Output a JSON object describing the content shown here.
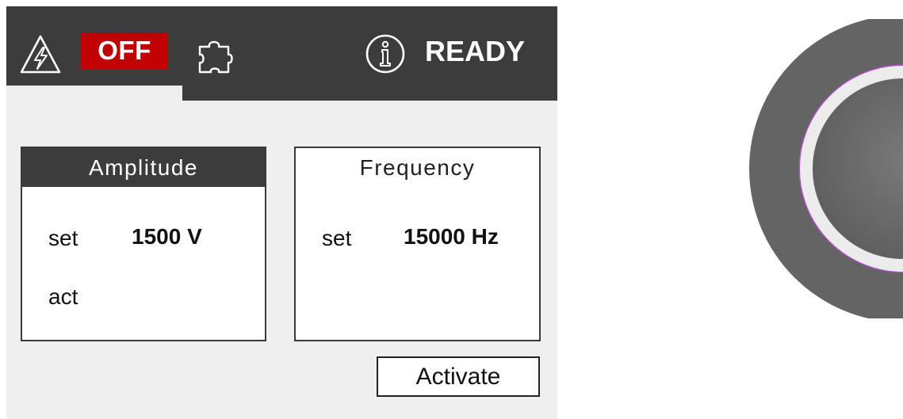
{
  "header": {
    "hv_icon": "high-voltage-warning-icon",
    "power_state": "OFF",
    "plugin_icon": "puzzle-icon",
    "info_icon": "info-icon",
    "status": "READY"
  },
  "amplitude": {
    "title": "Amplitude",
    "set_label": "set",
    "set_value": "1500 V",
    "act_label": "act",
    "act_value": ""
  },
  "frequency": {
    "title": "Frequency",
    "set_label": "set",
    "set_value": "15000 Hz"
  },
  "actions": {
    "activate_label": "Activate"
  },
  "colors": {
    "header_bg": "#3c3c3c",
    "off_badge": "#c00000",
    "panel_bg": "#efefef",
    "knob_outer": "#6b6b6b",
    "knob_ring": "#e8e8e8"
  }
}
